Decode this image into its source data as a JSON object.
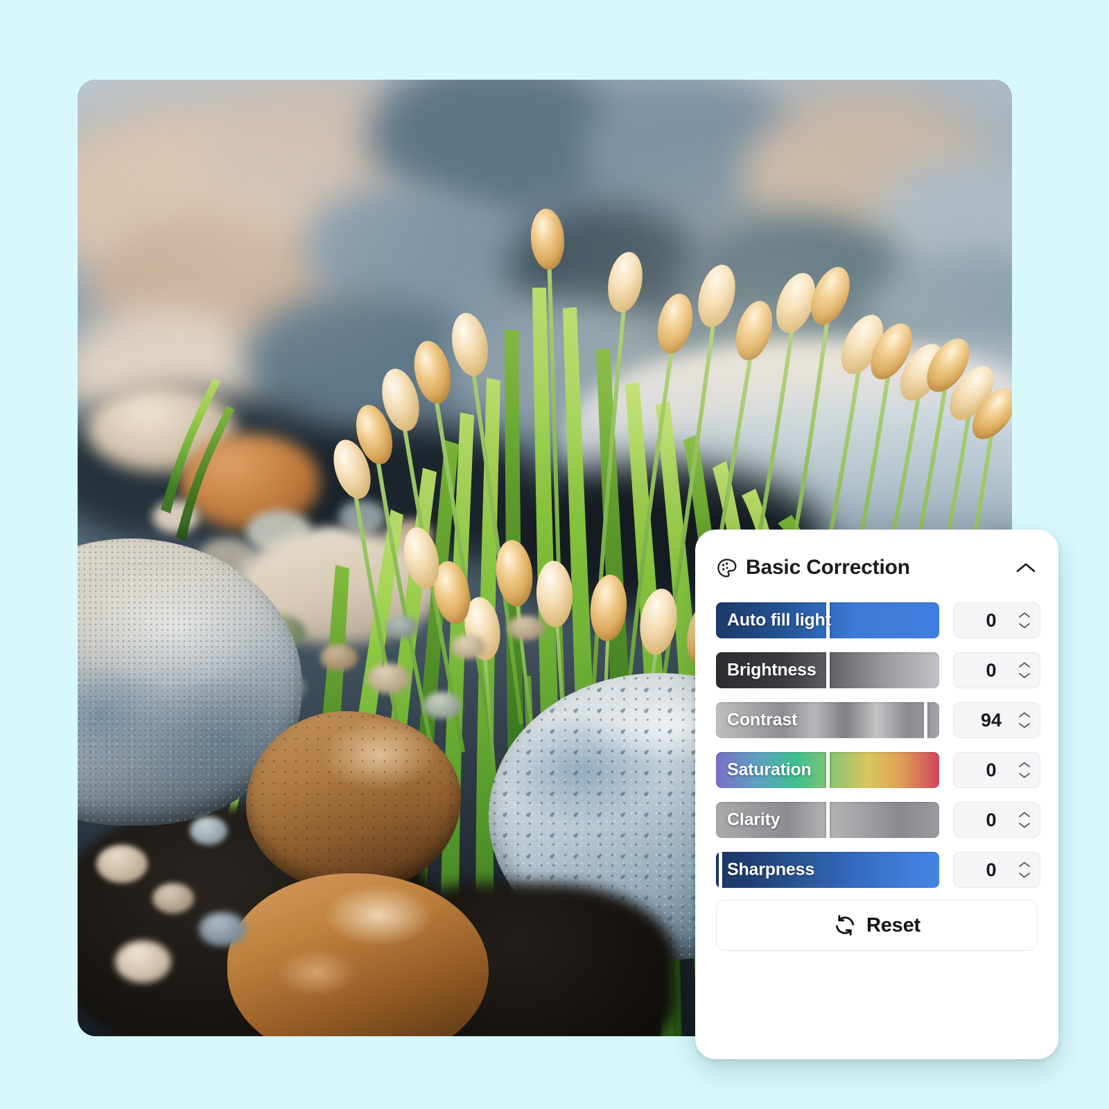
{
  "canvas": {
    "background_color": "#d7f9fc",
    "photo": {
      "alt": "close-up of ornamental grass with golden seed heads growing among smooth river pebbles",
      "subject": "grass-and-pebbles-photo"
    }
  },
  "panel": {
    "title": "Basic Correction",
    "icon": "palette-icon",
    "collapse_icon": "chevron-up-icon",
    "sliders": [
      {
        "label": "Auto fill light",
        "value": "0",
        "handle_percent": 50,
        "style": "blue",
        "gradient_from": "#1f3e6e",
        "gradient_to": "#3f7fe0"
      },
      {
        "label": "Brightness",
        "value": "0",
        "handle_percent": 50,
        "style": "gray-dark-to-light",
        "gradient_from": "#2f3033",
        "gradient_to": "#b9babd"
      },
      {
        "label": "Contrast",
        "value": "94",
        "handle_percent": 94,
        "style": "metallic-gray",
        "gradient_from": "#b2b3b5",
        "gradient_to": "#8c8d90"
      },
      {
        "label": "Saturation",
        "value": "0",
        "handle_percent": 50,
        "style": "rainbow",
        "gradient_from": "#7a6fc4",
        "gradient_to": "#d2455c"
      },
      {
        "label": "Clarity",
        "value": "0",
        "handle_percent": 50,
        "style": "soft-metallic",
        "gradient_from": "#9c9d9f",
        "gradient_to": "#8e8f92"
      },
      {
        "label": "Sharpness",
        "value": "0",
        "handle_percent": 2,
        "style": "blue",
        "gradient_from": "#1b3866",
        "gradient_to": "#3d7cdb"
      }
    ],
    "reset": {
      "label": "Reset",
      "icon": "refresh-icon"
    },
    "stepper_icons": {
      "up": "chevron-up-small-icon",
      "down": "chevron-down-small-icon"
    }
  },
  "colors": {
    "page_background": "#d7f9fc",
    "panel_background": "#ffffff",
    "accent_blue": "#3f7fe0",
    "text_primary": "#15151a",
    "input_background": "#f4f5f7"
  }
}
